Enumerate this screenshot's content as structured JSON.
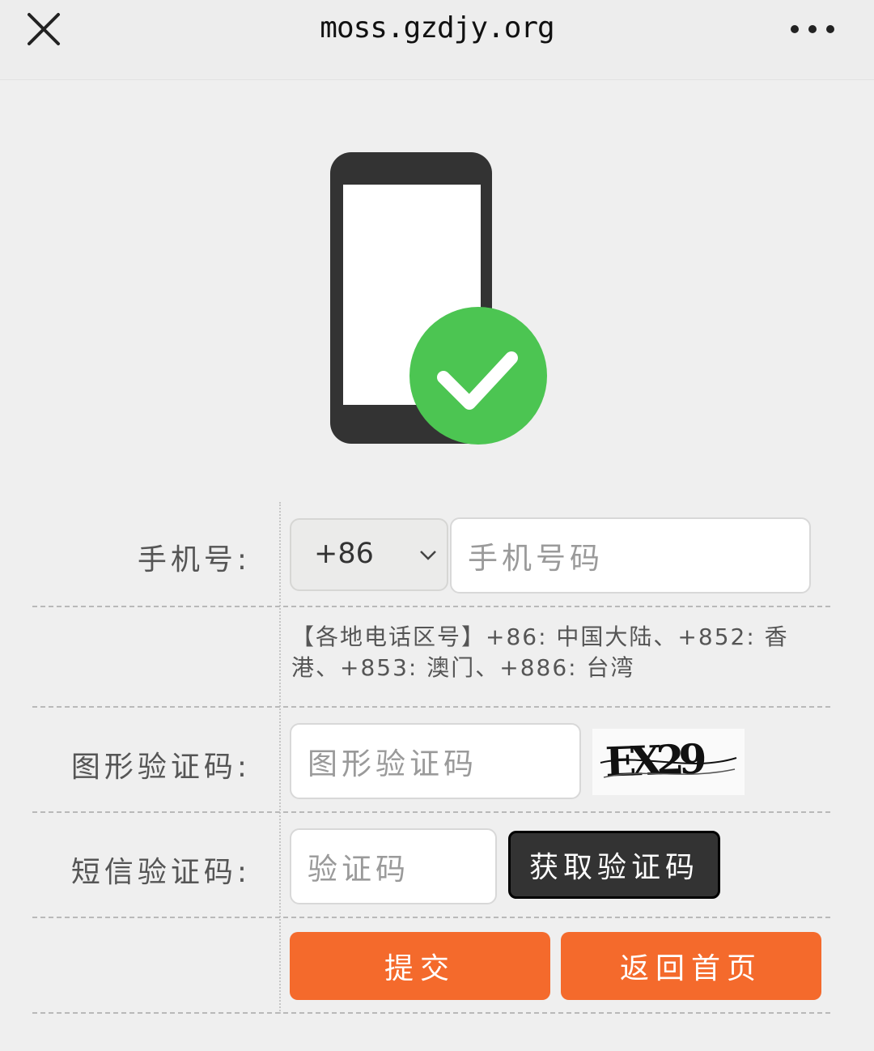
{
  "header": {
    "url": "moss.gzdjy.org",
    "close_icon": "close-icon",
    "more_icon": "more-dots-icon"
  },
  "hero": {
    "icon": "phone-verified-icon",
    "colors": {
      "phone_body": "#333333",
      "check_badge": "#4cc552"
    }
  },
  "form": {
    "phone": {
      "label": "手机号:",
      "country_code": "+86",
      "placeholder": "手机号码"
    },
    "area_code_hint": "【各地电话区号】+86: 中国大陆、+852: 香港、+853: 澳门、+886: 台湾",
    "captcha": {
      "label": "图形验证码:",
      "placeholder": "图形验证码",
      "image_text": "EX29"
    },
    "sms": {
      "label": "短信验证码:",
      "placeholder": "验证码",
      "button": "获取验证码"
    },
    "actions": {
      "submit": "提交",
      "back": "返回首页"
    },
    "colors": {
      "accent": "#f46a2c",
      "dark_button": "#333333"
    }
  }
}
